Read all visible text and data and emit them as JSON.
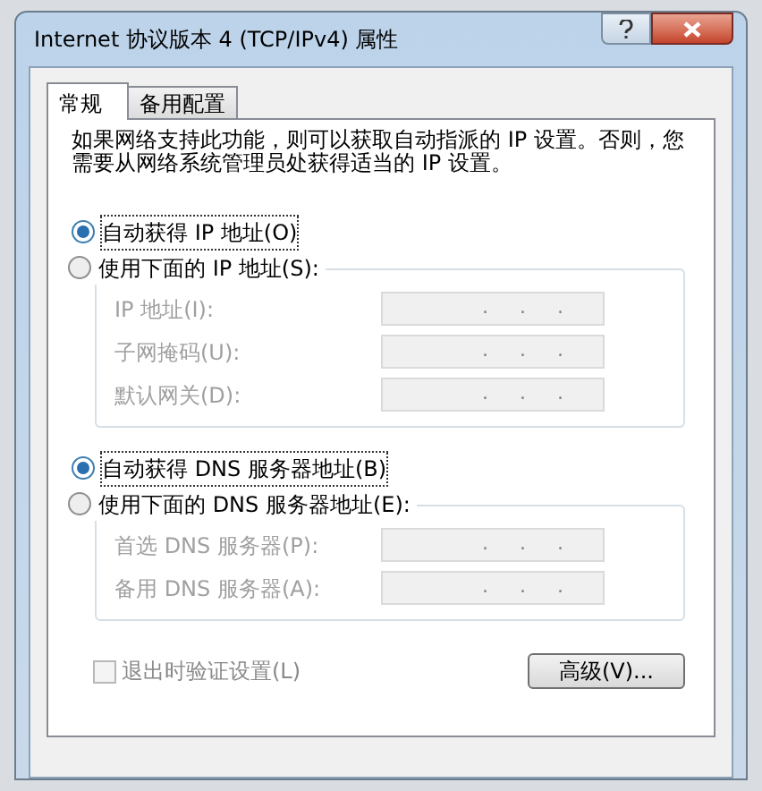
{
  "window": {
    "title": "Internet 协议版本 4 (TCP/IPv4) 属性"
  },
  "tabs": [
    {
      "label": "常规",
      "selected": true
    },
    {
      "label": "备用配置",
      "selected": false
    }
  ],
  "description": "如果网络支持此功能，则可以获取自动指派的 IP 设置。否则，您需要从网络系统管理员处获得适当的 IP 设置。",
  "ip_section": {
    "options": [
      {
        "label": "自动获得 IP 地址(O)",
        "selected": true
      },
      {
        "label": "使用下面的 IP 地址(S):",
        "selected": false
      }
    ],
    "fields": [
      {
        "label": "IP 地址(I):",
        "value": ".     .     .",
        "disabled": true
      },
      {
        "label": "子网掩码(U):",
        "value": ".     .     .",
        "disabled": true
      },
      {
        "label": "默认网关(D):",
        "value": ".     .     .",
        "disabled": true
      }
    ]
  },
  "dns_section": {
    "options": [
      {
        "label": "自动获得 DNS 服务器地址(B)",
        "selected": true
      },
      {
        "label": "使用下面的 DNS 服务器地址(E):",
        "selected": false
      }
    ],
    "fields": [
      {
        "label": "首选 DNS 服务器(P):",
        "value": ".     .     .",
        "disabled": true
      },
      {
        "label": "备用 DNS 服务器(A):",
        "value": ".     .     .",
        "disabled": true
      }
    ]
  },
  "validate_checkbox": {
    "label": "退出时验证设置(L)",
    "checked": false,
    "disabled": true
  },
  "advanced_button": {
    "label": "高级(V)..."
  }
}
